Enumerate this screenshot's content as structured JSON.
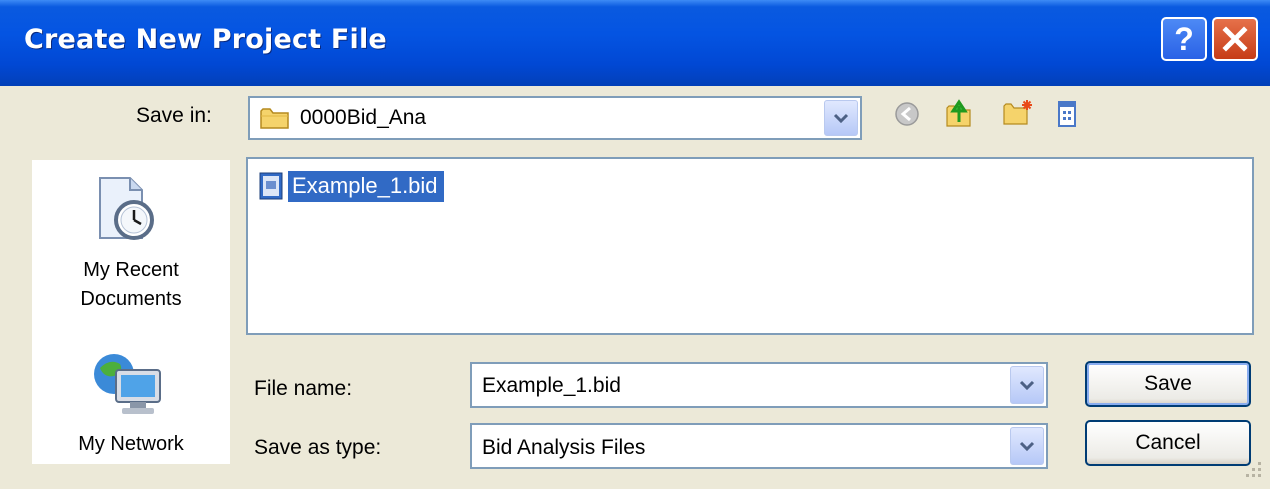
{
  "window": {
    "title": "Create New Project File"
  },
  "toolbar": {
    "save_in_label": "Save in:",
    "save_in_value": "0000Bid_Ana",
    "icons": [
      "back-icon",
      "up-folder-icon",
      "new-folder-icon",
      "view-menu-icon"
    ]
  },
  "places": [
    {
      "label_line1": "My Recent",
      "label_line2": "Documents",
      "icon": "recent-documents-icon"
    },
    {
      "label_line1": "My Network",
      "icon": "network-icon"
    }
  ],
  "file_list": {
    "items": [
      {
        "name": "Example_1.bid",
        "selected": true
      }
    ]
  },
  "form": {
    "file_name_label": "File name:",
    "file_name_value": "Example_1.bid",
    "save_type_label": "Save as type:",
    "save_type_value": "Bid Analysis Files"
  },
  "buttons": {
    "save": "Save",
    "cancel": "Cancel"
  },
  "colors": {
    "titlebar": "#0454e2",
    "selection": "#316ac5",
    "dialog_bg": "#ece9d8"
  }
}
